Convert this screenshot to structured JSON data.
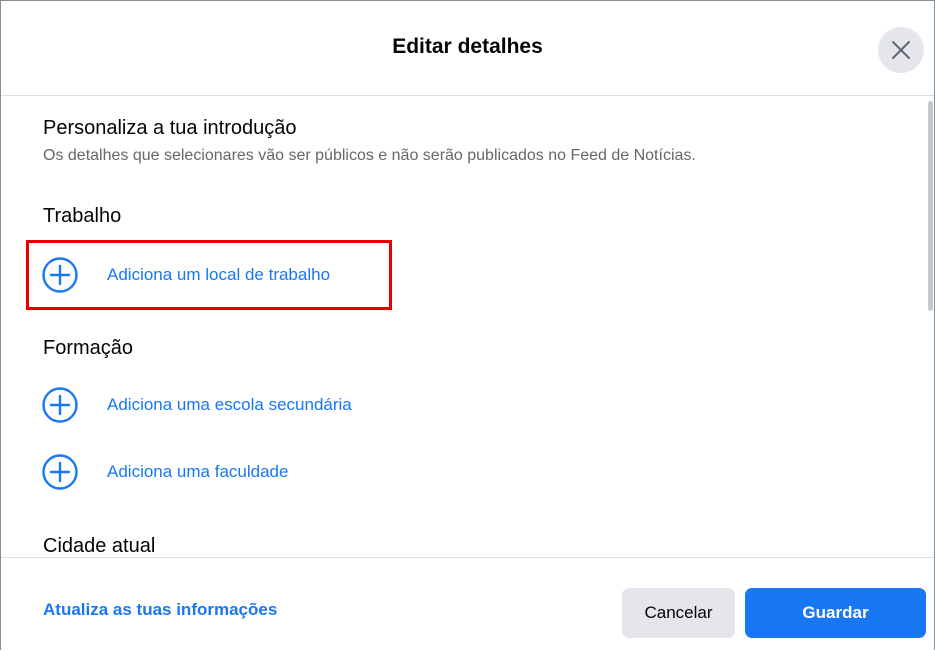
{
  "dialog": {
    "title": "Editar detalhes",
    "close_icon": "close-icon"
  },
  "intro": {
    "title": "Personaliza a tua introdução",
    "description": "Os detalhes que selecionares vão ser públicos e não serão publicados no Feed de Notícias."
  },
  "sections": {
    "work": {
      "title": "Trabalho",
      "add_label": "Adiciona um local de trabalho"
    },
    "education": {
      "title": "Formação",
      "add_high_school_label": "Adiciona uma escola secundária",
      "add_college_label": "Adiciona uma faculdade"
    },
    "city": {
      "title": "Cidade atual"
    }
  },
  "footer": {
    "update_link": "Atualiza as tuas informações",
    "cancel_label": "Cancelar",
    "save_label": "Guardar"
  },
  "icons": {
    "add": "plus-circle-icon",
    "close": "close-icon"
  },
  "colors": {
    "accent": "#1877f2",
    "highlight": "#e60000",
    "secondary_button": "#e4e6eb",
    "muted_text": "#65676b"
  }
}
